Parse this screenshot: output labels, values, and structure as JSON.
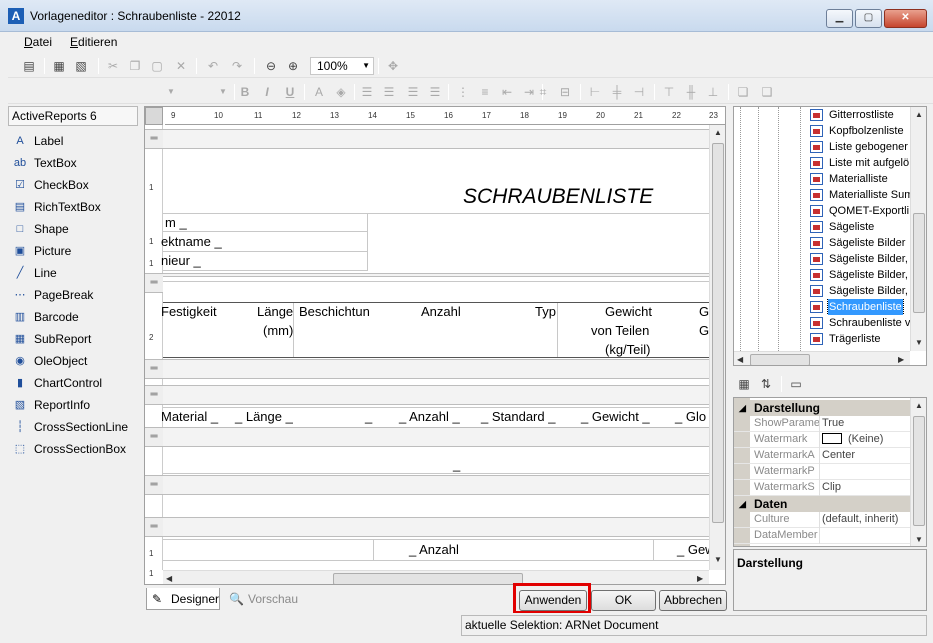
{
  "window": {
    "title": "Vorlageneditor : Schraubenliste - 22012",
    "app_icon": "A",
    "min_glyph": "▁",
    "max_glyph": "▢",
    "close_glyph": "✕"
  },
  "menu": [
    {
      "first": "D",
      "rest": "atei"
    },
    {
      "first": "E",
      "rest": "ditieren"
    }
  ],
  "toolbar": {
    "zoom": "100%",
    "zoom_arrow": "▼",
    "bold": "B",
    "italic": "I",
    "underline": "U"
  },
  "toolbox": {
    "header": "ActiveReports 6",
    "items": [
      {
        "label": "Label",
        "glyph": "A"
      },
      {
        "label": "TextBox",
        "glyph": "ab"
      },
      {
        "label": "CheckBox",
        "glyph": "☑"
      },
      {
        "label": "RichTextBox",
        "glyph": "▤"
      },
      {
        "label": "Shape",
        "glyph": "□"
      },
      {
        "label": "Picture",
        "glyph": "▣"
      },
      {
        "label": "Line",
        "glyph": "╱"
      },
      {
        "label": "PageBreak",
        "glyph": "⋯"
      },
      {
        "label": "Barcode",
        "glyph": "▥"
      },
      {
        "label": "SubReport",
        "glyph": "▦"
      },
      {
        "label": "OleObject",
        "glyph": "◉"
      },
      {
        "label": "ChartControl",
        "glyph": "▮"
      },
      {
        "label": "ReportInfo",
        "glyph": "▧"
      },
      {
        "label": "CrossSectionLine",
        "glyph": "┆"
      },
      {
        "label": "CrossSectionBox",
        "glyph": "⬚"
      }
    ]
  },
  "ruler": {
    "ticks": [
      "9",
      "10",
      "11",
      "12",
      "13",
      "14",
      "15",
      "16",
      "17",
      "18",
      "19",
      "20",
      "21",
      "22",
      "23"
    ],
    "v_marks": [
      "1",
      "1",
      "1",
      "2",
      "1",
      "1"
    ]
  },
  "report": {
    "title": "SCHRAUBENLISTE",
    "header_fields": [
      "m _",
      "ektname _",
      "nieur _"
    ],
    "columns": [
      {
        "l1": "Festigkeit",
        "l2": "",
        "l3": ""
      },
      {
        "l1": "Länge",
        "l2": "(mm)",
        "l3": ""
      },
      {
        "l1": "Beschichtun",
        "l2": "",
        "l3": ""
      },
      {
        "l1": "Anzahl",
        "l2": "",
        "l3": ""
      },
      {
        "l1": "Typ",
        "l2": "",
        "l3": ""
      },
      {
        "l1": "Gewicht",
        "l2": "von Teilen",
        "l3": "(kg/Teil)"
      },
      {
        "l1": "G",
        "l2": "G",
        "l3": ""
      }
    ],
    "detail_fields": [
      "Material _",
      "_ Länge _",
      "_",
      "_ Anzahl _",
      "_ Standard _",
      "_ Gewicht _",
      "_ Glo"
    ],
    "mid_field": "_",
    "footer_fields": [
      "_ Anzahl",
      "_ Gew"
    ],
    "band_glyph": "═"
  },
  "tabs": {
    "designer": "Designer",
    "preview": "Vorschau",
    "designer_icon": "✎",
    "preview_icon": "🔍"
  },
  "buttons": {
    "apply": "Anwenden",
    "ok": "OK",
    "cancel": "Abbrechen"
  },
  "status": {
    "selection": "aktuelle Selektion: ARNet Document"
  },
  "tree": {
    "items": [
      {
        "label": "Gitterrostliste",
        "selected": false
      },
      {
        "label": "Kopfbolzenliste",
        "selected": false
      },
      {
        "label": "Liste gebogener",
        "selected": false
      },
      {
        "label": "Liste mit aufgelö",
        "selected": false
      },
      {
        "label": "Materialliste",
        "selected": false
      },
      {
        "label": "Materialliste Sum",
        "selected": false
      },
      {
        "label": "QOMET-Exportli",
        "selected": false
      },
      {
        "label": "Sägeliste",
        "selected": false
      },
      {
        "label": "Sägeliste Bilder",
        "selected": false
      },
      {
        "label": "Sägeliste Bilder,",
        "selected": false
      },
      {
        "label": "Sägeliste Bilder,",
        "selected": false
      },
      {
        "label": "Sägeliste Bilder,",
        "selected": false
      },
      {
        "label": "Schraubenliste",
        "selected": true
      },
      {
        "label": "Schraubenliste v",
        "selected": false
      },
      {
        "label": "Trägerliste",
        "selected": false
      }
    ]
  },
  "properties": {
    "categories": [
      {
        "name": "Darstellung",
        "rows": [
          {
            "key": "ShowParame",
            "value": "True",
            "swatch": false
          },
          {
            "key": "Watermark",
            "value": "(Keine)",
            "swatch": true
          },
          {
            "key": "WatermarkA",
            "value": "Center",
            "swatch": false
          },
          {
            "key": "WatermarkP",
            "value": "",
            "swatch": false
          },
          {
            "key": "WatermarkS",
            "value": "Clip",
            "swatch": false
          }
        ]
      },
      {
        "name": "Daten",
        "rows": [
          {
            "key": "Culture",
            "value": "(default, inherit)",
            "swatch": false
          },
          {
            "key": "DataMember",
            "value": "",
            "swatch": false
          }
        ]
      }
    ],
    "description_title": "Darstellung"
  },
  "colors": {
    "selection": "#3399ff",
    "highlight_box": "#e10000"
  }
}
